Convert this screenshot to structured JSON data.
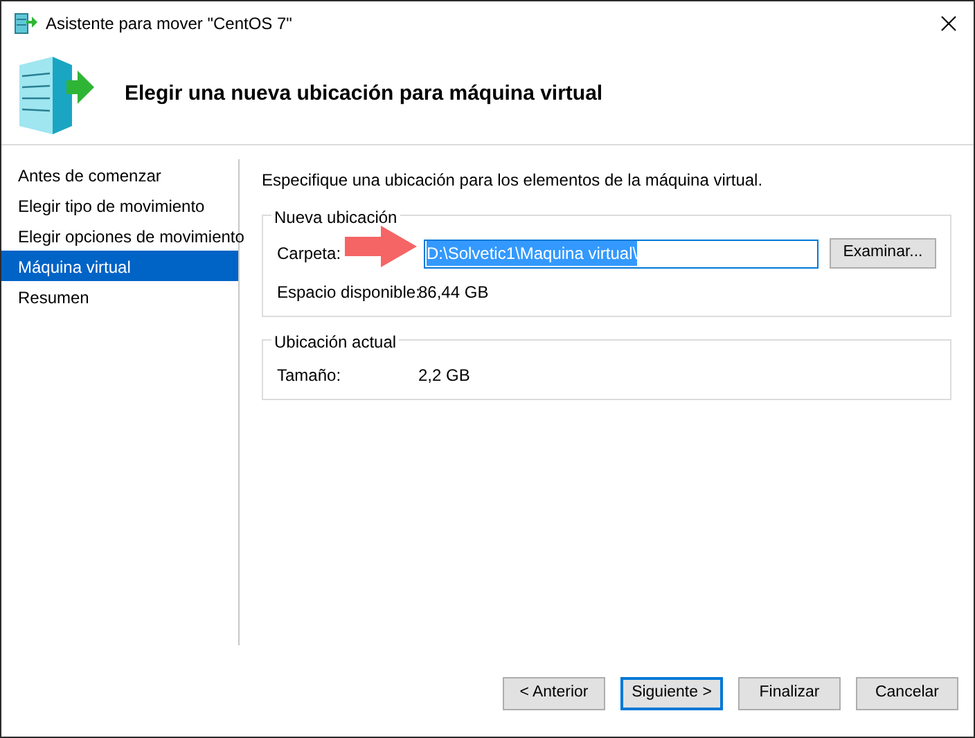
{
  "window": {
    "title": "Asistente para mover \"CentOS 7\""
  },
  "header": {
    "title": "Elegir una nueva ubicación para máquina virtual"
  },
  "sidebar": {
    "items": [
      {
        "label": "Antes de comenzar",
        "selected": false
      },
      {
        "label": "Elegir tipo de movimiento",
        "selected": false
      },
      {
        "label": "Elegir opciones de movimiento",
        "selected": false
      },
      {
        "label": "Máquina virtual",
        "selected": true
      },
      {
        "label": "Resumen",
        "selected": false
      }
    ]
  },
  "intro": "Especifique una ubicación para los elementos de la máquina virtual.",
  "new_location": {
    "legend": "Nueva ubicación",
    "folder_label": "Carpeta:",
    "folder_value": "D:\\Solvetic1\\Maquina virtual\\",
    "value_selected": true,
    "browse_button": "Examinar...",
    "space_label": "Espacio disponible:",
    "space_value": "86,44 GB"
  },
  "current_location": {
    "legend": "Ubicación actual",
    "size_label": "Tamaño:",
    "size_value": "2,2 GB"
  },
  "buttons": [
    {
      "label": "< Anterior",
      "default": false
    },
    {
      "label": "Siguiente >",
      "default": true
    },
    {
      "label": "Finalizar",
      "default": false
    },
    {
      "label": "Cancelar",
      "default": false
    }
  ]
}
